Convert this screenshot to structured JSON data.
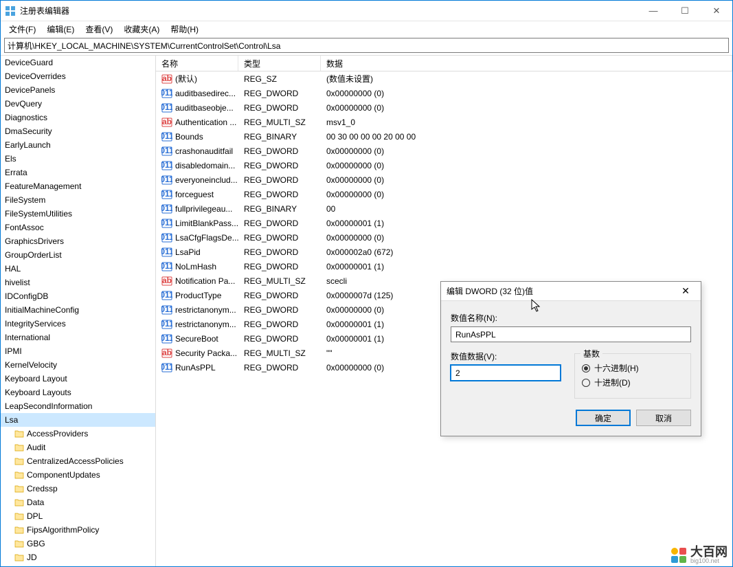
{
  "window": {
    "title": "注册表编辑器"
  },
  "menubar": [
    "文件(F)",
    "编辑(E)",
    "查看(V)",
    "收藏夹(A)",
    "帮助(H)"
  ],
  "address": "计算机\\HKEY_LOCAL_MACHINE\\SYSTEM\\CurrentControlSet\\Control\\Lsa",
  "tree": {
    "items": [
      {
        "name": "DeviceGuard"
      },
      {
        "name": "DeviceOverrides"
      },
      {
        "name": "DevicePanels"
      },
      {
        "name": "DevQuery"
      },
      {
        "name": "Diagnostics"
      },
      {
        "name": "DmaSecurity"
      },
      {
        "name": "EarlyLaunch"
      },
      {
        "name": "Els"
      },
      {
        "name": "Errata"
      },
      {
        "name": "FeatureManagement"
      },
      {
        "name": "FileSystem"
      },
      {
        "name": "FileSystemUtilities"
      },
      {
        "name": "FontAssoc"
      },
      {
        "name": "GraphicsDrivers"
      },
      {
        "name": "GroupOrderList"
      },
      {
        "name": "HAL"
      },
      {
        "name": "hivelist"
      },
      {
        "name": "IDConfigDB"
      },
      {
        "name": "InitialMachineConfig"
      },
      {
        "name": "IntegrityServices"
      },
      {
        "name": "International"
      },
      {
        "name": "IPMI"
      },
      {
        "name": "KernelVelocity"
      },
      {
        "name": "Keyboard Layout"
      },
      {
        "name": "Keyboard Layouts"
      },
      {
        "name": "LeapSecondInformation"
      },
      {
        "name": "Lsa",
        "selected": true
      },
      {
        "name": "AccessProviders",
        "sub": true
      },
      {
        "name": "Audit",
        "sub": true
      },
      {
        "name": "CentralizedAccessPolicies",
        "sub": true
      },
      {
        "name": "ComponentUpdates",
        "sub": true
      },
      {
        "name": "Credssp",
        "sub": true
      },
      {
        "name": "Data",
        "sub": true
      },
      {
        "name": "DPL",
        "sub": true
      },
      {
        "name": "FipsAlgorithmPolicy",
        "sub": true
      },
      {
        "name": "GBG",
        "sub": true
      },
      {
        "name": "JD",
        "sub": true
      }
    ]
  },
  "list": {
    "columns": {
      "name": "名称",
      "type": "类型",
      "data": "数据"
    },
    "rows": [
      {
        "name": "(默认)",
        "type": "REG_SZ",
        "data": "(数值未设置)",
        "icon": "sz"
      },
      {
        "name": "auditbasedirec...",
        "type": "REG_DWORD",
        "data": "0x00000000 (0)",
        "icon": "dw"
      },
      {
        "name": "auditbaseobje...",
        "type": "REG_DWORD",
        "data": "0x00000000 (0)",
        "icon": "dw"
      },
      {
        "name": "Authentication ...",
        "type": "REG_MULTI_SZ",
        "data": "msv1_0",
        "icon": "sz"
      },
      {
        "name": "Bounds",
        "type": "REG_BINARY",
        "data": "00 30 00 00 00 20 00 00",
        "icon": "dw"
      },
      {
        "name": "crashonauditfail",
        "type": "REG_DWORD",
        "data": "0x00000000 (0)",
        "icon": "dw"
      },
      {
        "name": "disabledomain...",
        "type": "REG_DWORD",
        "data": "0x00000000 (0)",
        "icon": "dw"
      },
      {
        "name": "everyoneinclud...",
        "type": "REG_DWORD",
        "data": "0x00000000 (0)",
        "icon": "dw"
      },
      {
        "name": "forceguest",
        "type": "REG_DWORD",
        "data": "0x00000000 (0)",
        "icon": "dw"
      },
      {
        "name": "fullprivilegeau...",
        "type": "REG_BINARY",
        "data": "00",
        "icon": "dw"
      },
      {
        "name": "LimitBlankPass...",
        "type": "REG_DWORD",
        "data": "0x00000001 (1)",
        "icon": "dw"
      },
      {
        "name": "LsaCfgFlagsDe...",
        "type": "REG_DWORD",
        "data": "0x00000000 (0)",
        "icon": "dw"
      },
      {
        "name": "LsaPid",
        "type": "REG_DWORD",
        "data": "0x000002a0 (672)",
        "icon": "dw"
      },
      {
        "name": "NoLmHash",
        "type": "REG_DWORD",
        "data": "0x00000001 (1)",
        "icon": "dw"
      },
      {
        "name": "Notification Pa...",
        "type": "REG_MULTI_SZ",
        "data": "scecli",
        "icon": "sz"
      },
      {
        "name": "ProductType",
        "type": "REG_DWORD",
        "data": "0x0000007d (125)",
        "icon": "dw"
      },
      {
        "name": "restrictanonym...",
        "type": "REG_DWORD",
        "data": "0x00000000 (0)",
        "icon": "dw"
      },
      {
        "name": "restrictanonym...",
        "type": "REG_DWORD",
        "data": "0x00000001 (1)",
        "icon": "dw"
      },
      {
        "name": "SecureBoot",
        "type": "REG_DWORD",
        "data": "0x00000001 (1)",
        "icon": "dw"
      },
      {
        "name": "Security Packa...",
        "type": "REG_MULTI_SZ",
        "data": "\"\"",
        "icon": "sz"
      },
      {
        "name": "RunAsPPL",
        "type": "REG_DWORD",
        "data": "0x00000000 (0)",
        "icon": "dw"
      }
    ]
  },
  "dialog": {
    "title": "编辑 DWORD (32 位)值",
    "name_label": "数值名称(N):",
    "name_value": "RunAsPPL",
    "data_label": "数值数据(V):",
    "data_value": "2",
    "base_label": "基数",
    "hex_label": "十六进制(H)",
    "dec_label": "十进制(D)",
    "ok": "确定",
    "cancel": "取消"
  },
  "watermark": {
    "big": "大百网",
    "small": "big100.net"
  }
}
